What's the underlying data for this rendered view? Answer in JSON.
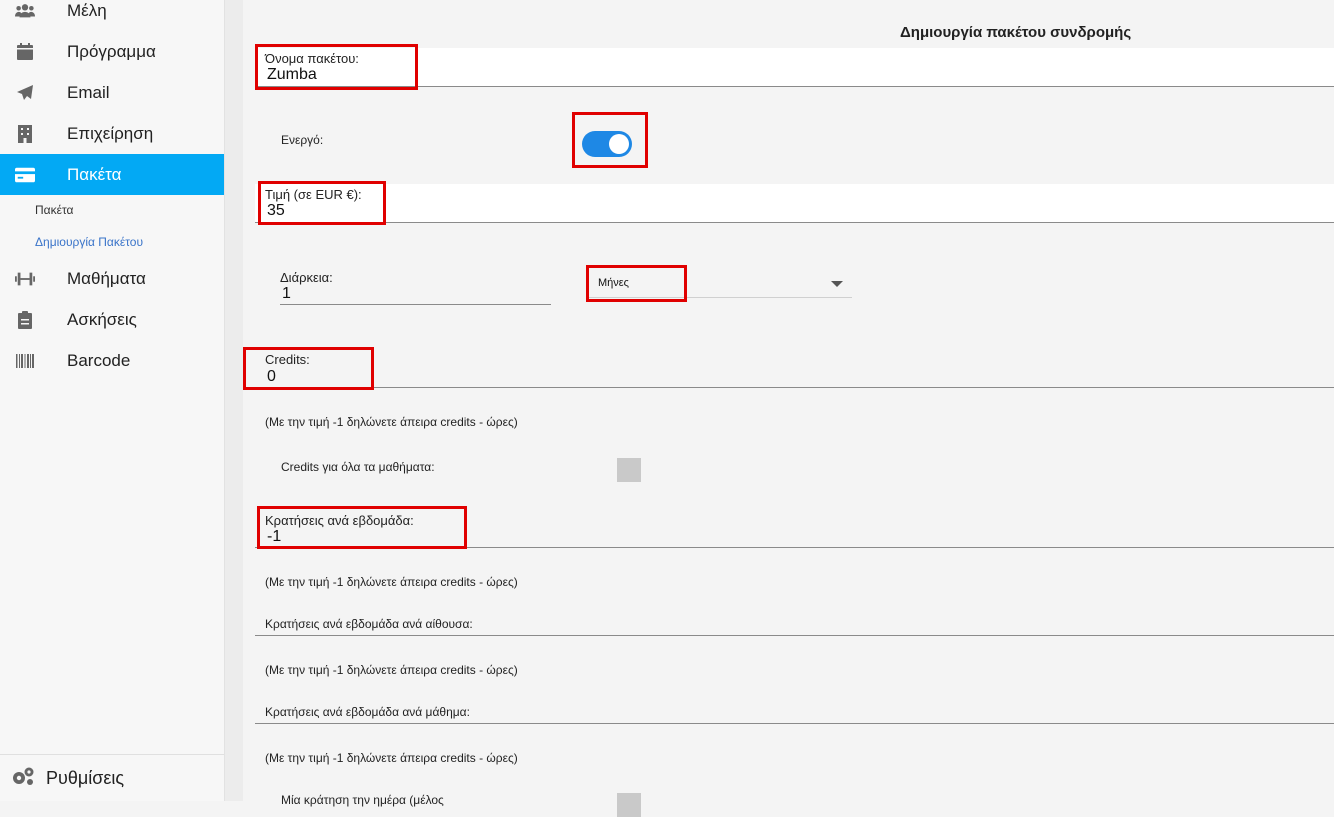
{
  "sidebar": {
    "items": [
      {
        "label": "Μέλη",
        "icon": "users-icon"
      },
      {
        "label": "Πρόγραμμα",
        "icon": "calendar-icon"
      },
      {
        "label": "Email",
        "icon": "paper-plane-icon"
      },
      {
        "label": "Επιχείρηση",
        "icon": "building-icon"
      },
      {
        "label": "Πακέτα",
        "icon": "credit-card-icon",
        "active": true
      },
      {
        "label": "Μαθήματα",
        "icon": "dumbbell-icon"
      },
      {
        "label": "Ασκήσεις",
        "icon": "clipboard-icon"
      },
      {
        "label": "Barcode",
        "icon": "barcode-icon"
      }
    ],
    "subitems": [
      {
        "label": "Πακέτα"
      },
      {
        "label": "Δημιουργία Πακέτου"
      }
    ],
    "settings": {
      "label": "Ρυθμίσεις",
      "icon": "cogs-icon"
    }
  },
  "form": {
    "title": "Δημιουργία πακέτου συνδρομής",
    "name": {
      "label": "Όνομα πακέτου:",
      "value": "Zumba"
    },
    "active": {
      "label": "Ενεργό:",
      "on": true
    },
    "price": {
      "label": "Τιμή (σε EUR €):",
      "value": "35"
    },
    "duration": {
      "label": "Διάρκεια:",
      "value": "1",
      "unit": "Μήνες"
    },
    "credits": {
      "label": "Credits:",
      "value": "0",
      "hint": "(Με την τιμή -1 δηλώνετε άπειρα credits - ώρες)"
    },
    "credits_all": {
      "label": "Credits για όλα τα μαθήματα:"
    },
    "weekly": {
      "label": "Κρατήσεις ανά εβδομάδα:",
      "value": "-1",
      "hint": "(Με την τιμή -1 δηλώνετε άπειρα credits - ώρες)"
    },
    "weekly_room": {
      "label": "Κρατήσεις ανά εβδομάδα ανά αίθουσα:",
      "hint": "(Με την τιμή -1 δηλώνετε άπειρα credits - ώρες)"
    },
    "weekly_class": {
      "label": "Κρατήσεις ανά εβδομάδα ανά μάθημα:",
      "hint": "(Με την τιμή -1 δηλώνετε άπειρα credits - ώρες)"
    },
    "cut_label": "Μία κράτηση την ημέρα (μέλος"
  },
  "colors": {
    "accent": "#03a9f4",
    "toggle": "#1e88e5",
    "highlight": "#e00000"
  }
}
